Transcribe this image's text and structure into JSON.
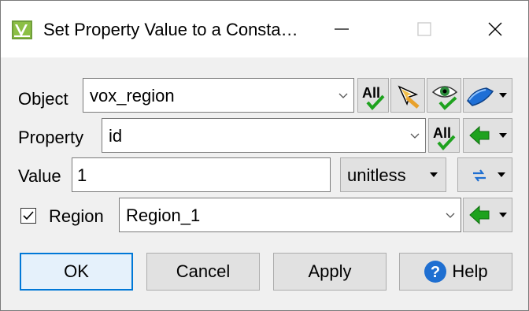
{
  "window": {
    "title": "Set Property Value to a Consta…",
    "icon": "app-logo-icon",
    "controls": [
      "minimize-icon",
      "maximize-icon",
      "close-icon"
    ]
  },
  "form": {
    "object": {
      "label": "Object",
      "value": "vox_region"
    },
    "property": {
      "label": "Property",
      "value": "id"
    },
    "value": {
      "label": "Value",
      "input": "1",
      "unit": "unitless"
    },
    "region": {
      "label": "Region",
      "checked": true,
      "value": "Region_1"
    }
  },
  "buttons": {
    "ok": "OK",
    "cancel": "Cancel",
    "apply": "Apply",
    "help": "Help"
  },
  "colors": {
    "accent": "#0078d7",
    "green": "#1ea21e",
    "help_blue": "#1f6fd1"
  }
}
